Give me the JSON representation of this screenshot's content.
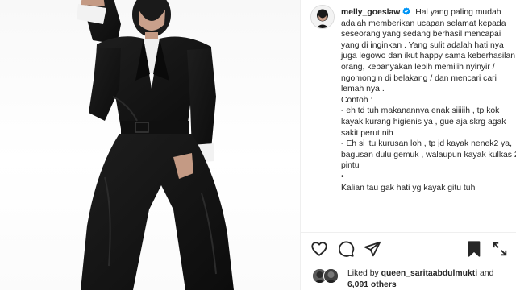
{
  "post": {
    "author": {
      "username": "melly_goeslaw",
      "verified": true
    },
    "caption": "Hal yang paling mudah adalah memberikan ucapan selamat kepada seseorang yang sedang berhasil mencapai yang di inginkan . Yang sulit adalah hati nya juga legowo dan ikut happy sama keberhasilan orang, kebanyakan lebih memilih nyinyir / ngomongin di belakang / dan mencari cari lemah nya .\nContoh :\n- eh td tuh makanannya enak siiiiih , tp kok kayak kurang higienis ya , gue aja skrg agak sakit perut nih\n- Eh si itu kurusan loh , tp jd kayak nenek2 ya, bagusan dulu gemuk , walaupun kayak kulkas 2 pintu\n•\nKalian tau gak hati yg kayak gitu tuh",
    "likes": {
      "prefix": "Liked by",
      "user": "queen_saritaabdulmukti",
      "joiner": "and",
      "others": "6,091 others"
    }
  },
  "icons": {
    "verified": "verified-badge-icon",
    "like": "heart-icon",
    "comment": "comment-icon",
    "share": "paper-plane-icon",
    "save": "bookmark-icon"
  },
  "colors": {
    "verified": "#0095f6",
    "text": "#262626",
    "divider": "#efefef",
    "suit": "#141414"
  }
}
